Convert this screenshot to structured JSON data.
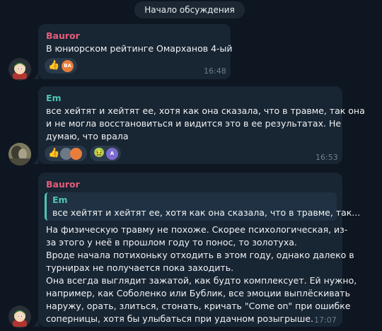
{
  "date_pill": "Начало обсуждения",
  "messages": [
    {
      "author": "Bauror",
      "text": [
        "В юниорском рейтинге Омарханов 4-ый"
      ],
      "time": "16:48",
      "reactions": {
        "thumb": "👍",
        "avatar_initials": "ВА"
      }
    },
    {
      "author": "Em",
      "text": [
        "все хейтят и хейтят ее, хотя как она сказала, что в травме, так она",
        "и не могла восстановиться и видится это в ее результатах. Не",
        "думаю, что врала"
      ],
      "time": "16:53",
      "reactions": {
        "thumb": "👍",
        "nausea": "🤢",
        "avatar_initial": "А"
      }
    },
    {
      "author": "Bauror",
      "quote": {
        "author": "Em",
        "text": "все хейтят и хейтят ее, хотя как она сказала, что в травме, так..."
      },
      "text": [
        "На физическую травму не похоже. Скорее психологическая, из-",
        "за этого у неё в прошлом году то понос, то золотуха.",
        "Вроде начала потихоньку отходить в этом году, однако далеко в",
        "турнирах не получается пока заходить.",
        "Она всегда выглядит зажатой, как будто комплексует. Ей нужно,",
        "например, как Соболенко или Бублик, все эмоции выплёскивать",
        "наружу, орать, злиться, стонать, кричать \"Come on\" при ошибке",
        "соперницы, хотя бы улыбаться при удачном розыгрыше."
      ],
      "time": "17:07"
    }
  ]
}
